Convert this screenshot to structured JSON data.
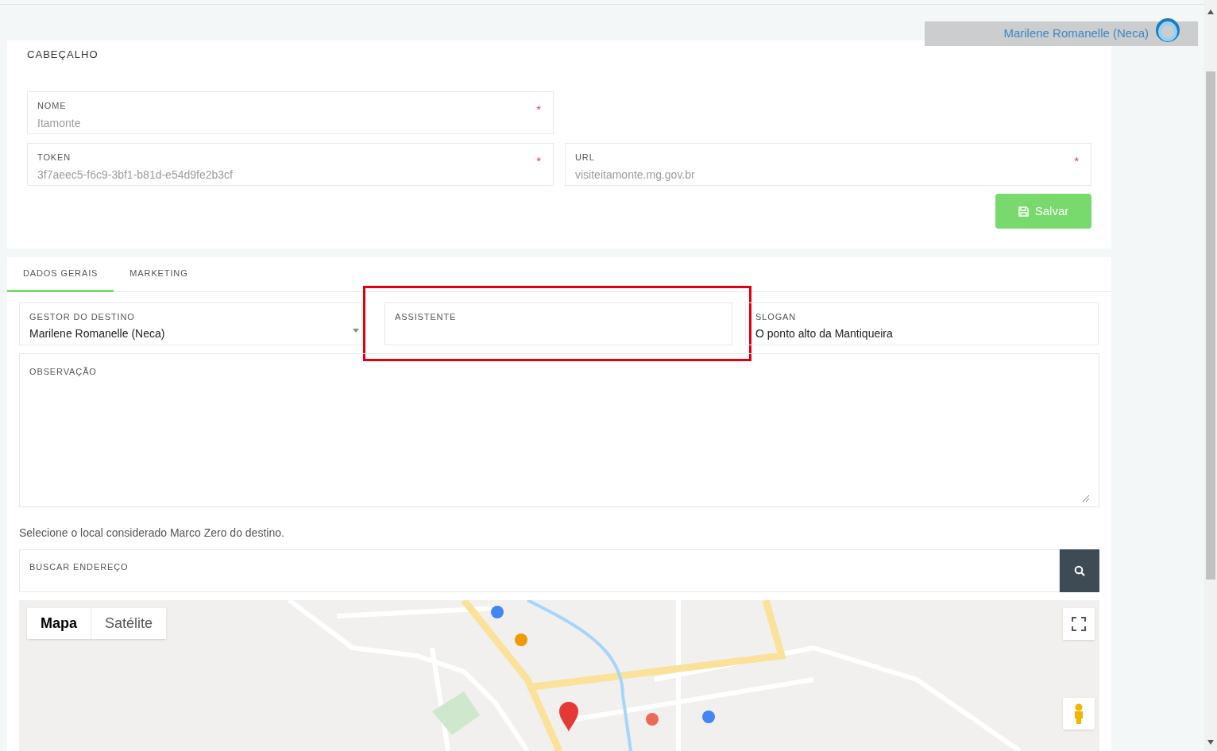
{
  "user_bar": {
    "name": "Marilene Romanelle (Neca)"
  },
  "header": {
    "title": "CABEÇALHO",
    "fields": [
      {
        "label": "NOME",
        "value": "Itamonte",
        "marker": "*",
        "disabled": true
      },
      {
        "label": "TOKEN",
        "value": "3f7aeec5-f6c9-3bf1-b81d-e54d9fe2b3cf",
        "marker": "*",
        "disabled": true
      },
      {
        "label": "URL",
        "value": "visiteitamonte.mg.gov.br",
        "marker": "*",
        "disabled": true
      }
    ],
    "save_button": "Salvar"
  },
  "tabs": [
    {
      "label": "DADOS GERAIS",
      "selected": true
    },
    {
      "label": "MARKETING",
      "selected": false
    }
  ],
  "general": {
    "fields": [
      {
        "kind": "select",
        "label": "GESTOR DO DESTINO",
        "value": "Marilene Romanelle (Neca)"
      },
      {
        "kind": "text",
        "label": "ASSISTENTE",
        "highlighted": true
      },
      {
        "kind": "text",
        "label": "SLOGAN",
        "value": "O ponto alto da Mantiqueira"
      }
    ],
    "observation": {
      "label": "OBSERVAÇÃO"
    },
    "hint": "Selecione o local considerado Marco Zero do destino.",
    "address_search": {
      "label": "BUSCAR ENDEREÇO"
    },
    "map": {
      "kind": "picture",
      "map_types": [
        {
          "label": "Mapa",
          "selected": true
        },
        {
          "label": "Satélite",
          "selected": false
        }
      ]
    }
  }
}
